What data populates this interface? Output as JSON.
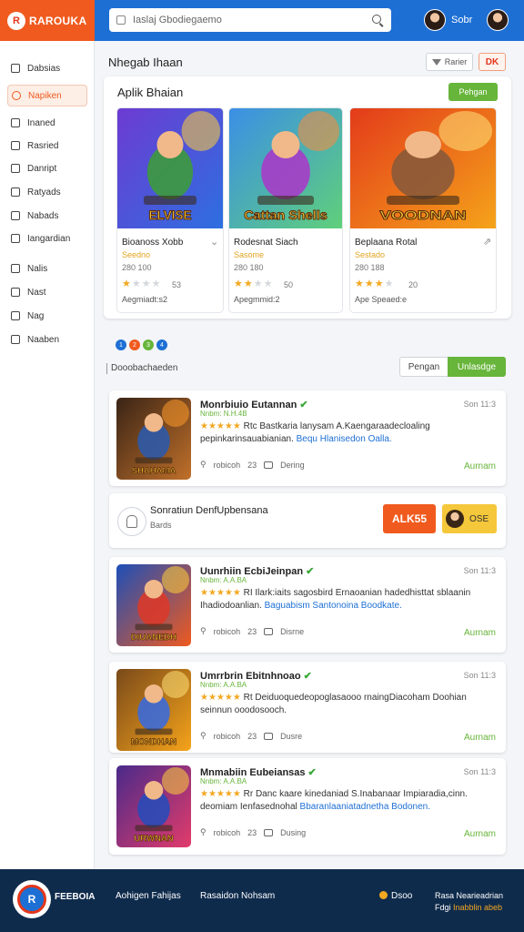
{
  "header": {
    "brand": "RAROUKA",
    "logo_letter": "R",
    "search_placeholder": "Iaslaj Gbodiegaemo",
    "user": "Sobr"
  },
  "sidebar": {
    "items": [
      {
        "label": "Dabsias",
        "active": false
      },
      {
        "label": "Napiken",
        "active": true
      },
      {
        "label": "Inaned",
        "active": false
      },
      {
        "label": "Rasried",
        "active": false
      },
      {
        "label": "Danript",
        "active": false
      },
      {
        "label": "Ratyads",
        "active": false
      },
      {
        "label": "Nabads",
        "active": false
      },
      {
        "label": "Iangardian",
        "active": false
      },
      {
        "label": "Nalis",
        "active": false
      },
      {
        "label": "Nast",
        "active": false
      },
      {
        "label": "Nag",
        "active": false
      },
      {
        "label": "Naaben",
        "active": false
      }
    ]
  },
  "page": {
    "title": "Nhegab Ihaan",
    "filter_label": "Rarier",
    "close_label": "DK"
  },
  "featured": {
    "title": "Aplik Bhaian",
    "button": "Pehgan",
    "cards": [
      {
        "name": "Bioanoss Xobb",
        "genre": "Seedno",
        "size": "280 100",
        "score": "53",
        "meta": "Aegmiadt:s2",
        "art": "ELVISE",
        "rating": 1
      },
      {
        "name": "Rodesnat Siach",
        "genre": "Sasome",
        "size": "280 180",
        "score": "50",
        "meta": "Apegmmid:2",
        "art": "Cattan Shells",
        "rating": 2
      },
      {
        "name": "Beplaana Rotal",
        "genre": "Sestado",
        "size": "280 188",
        "score": "20",
        "meta": "Ape Speaed:e",
        "art": "VOODNAN",
        "rating": 3
      }
    ]
  },
  "pager": {
    "dots": [
      "1",
      "2",
      "3",
      "4"
    ]
  },
  "subbar": {
    "label": "Dooobachaeden",
    "tabs": [
      "Pengan",
      "Unlasdge"
    ]
  },
  "listings": [
    {
      "name": "Monrbiuio Eutannan",
      "sub": "Nnbm:  N.H.4B",
      "desc": "Rtc Bastkaria lanysam A.Kaengaraadecloaling pepinkarinsauabianian. ",
      "desc_hl": "Bequ Hlanisedon Oalla.",
      "time": "Son 11:3",
      "likes": "23",
      "comments": "Dering",
      "views": "robicoh",
      "action": "Aurnam",
      "art": "SHAHAMA"
    },
    {
      "name": "Uunrhiin EcbiJeinpan",
      "sub": "Nnbm:  A.A.BA",
      "desc": "RI Ilark:iaits sagosbird Ernaoanian hadedhisttat sblaanin Ihadiodoanlian. ",
      "desc_hl": "Baguabism Santonoina Boodkate.",
      "time": "Son 11:3",
      "likes": "23",
      "comments": "Disrne",
      "views": "robicoh",
      "action": "Aurnam",
      "art": "DIUANEDH"
    },
    {
      "name": "Umrrbrin Ebitnhnoao",
      "sub": "Nnbm:  A.A.BA",
      "desc": "Rt Deiduoquedeopoglasaooo rnaingDiacoham Doohian seinnun ooodosooch.",
      "desc_hl": "",
      "time": "Son 11:3",
      "likes": "23",
      "comments": "Dusre",
      "views": "robicoh",
      "action": "Aurnam",
      "art": "MONDHAN"
    },
    {
      "name": "Mnmabiin Eubeiansas",
      "sub": "Nnbm:  A.A.BA",
      "desc": "Rr Danc kaare kinedaniad S.Inabanaar Impiaradia,cinn. deomiam Ienfasednohal ",
      "desc_hl": "Bbaranlaaniatadnetha Bodonen.",
      "time": "Son 11:3",
      "likes": "23",
      "comments": "Dusing",
      "views": "robicoh",
      "action": "Aurnam",
      "art": "URWNAN"
    }
  ],
  "promo": {
    "title": "Sonratiun DenfUpbensana",
    "sub": "Bards",
    "red_label": "ALK55",
    "yellow_label": "OSE"
  },
  "footer": {
    "brand": "FEEBOIA",
    "col1": "Aohigen Fahijas",
    "col2": "Rasaidon Nohsam",
    "badge": "Dsoo",
    "right1": "Rasa Nearieadrian",
    "right2_a": "Fdgi ",
    "right2_b": "Inabblin abeb"
  },
  "colors": {
    "header_blue": "#1d6fd4",
    "brand_orange": "#f05a1e",
    "accent_green": "#67b53a",
    "star_gold": "#f3a821",
    "footer_navy": "#0f2b4c"
  }
}
